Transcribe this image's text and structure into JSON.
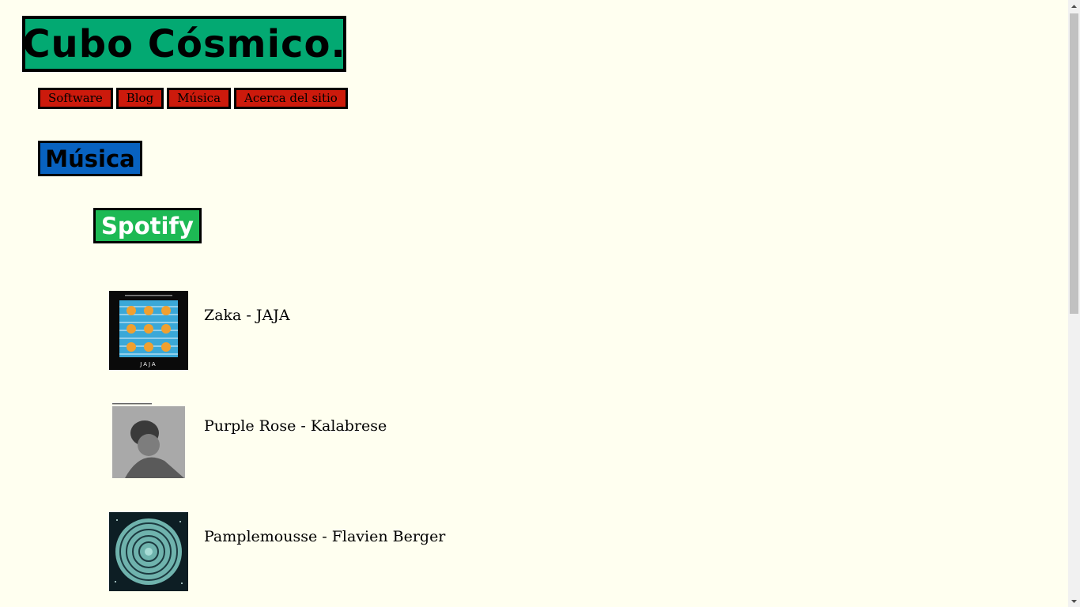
{
  "site": {
    "title": "Cubo Cósmico."
  },
  "nav": {
    "items": [
      {
        "label": "Software"
      },
      {
        "label": "Blog"
      },
      {
        "label": "Música"
      },
      {
        "label": "Acerca del sitio"
      }
    ]
  },
  "section": {
    "title": "Música"
  },
  "subsection": {
    "title": "Spotify"
  },
  "tracks": [
    {
      "name": "Zaka - JAJA",
      "cover_icon": "album-cover-zaka-jaja",
      "cover_text": "JAJA"
    },
    {
      "name": "Purple Rose - Kalabrese",
      "cover_icon": "album-cover-purple-rose"
    },
    {
      "name": "Pamplemousse - Flavien Berger",
      "cover_icon": "album-cover-pamplemousse"
    }
  ],
  "colors": {
    "background": "#fffff0",
    "title_bg": "#03a972",
    "nav_bg": "#cc1a0c",
    "section_bg": "#0862c0",
    "spotify_bg": "#1db954"
  }
}
